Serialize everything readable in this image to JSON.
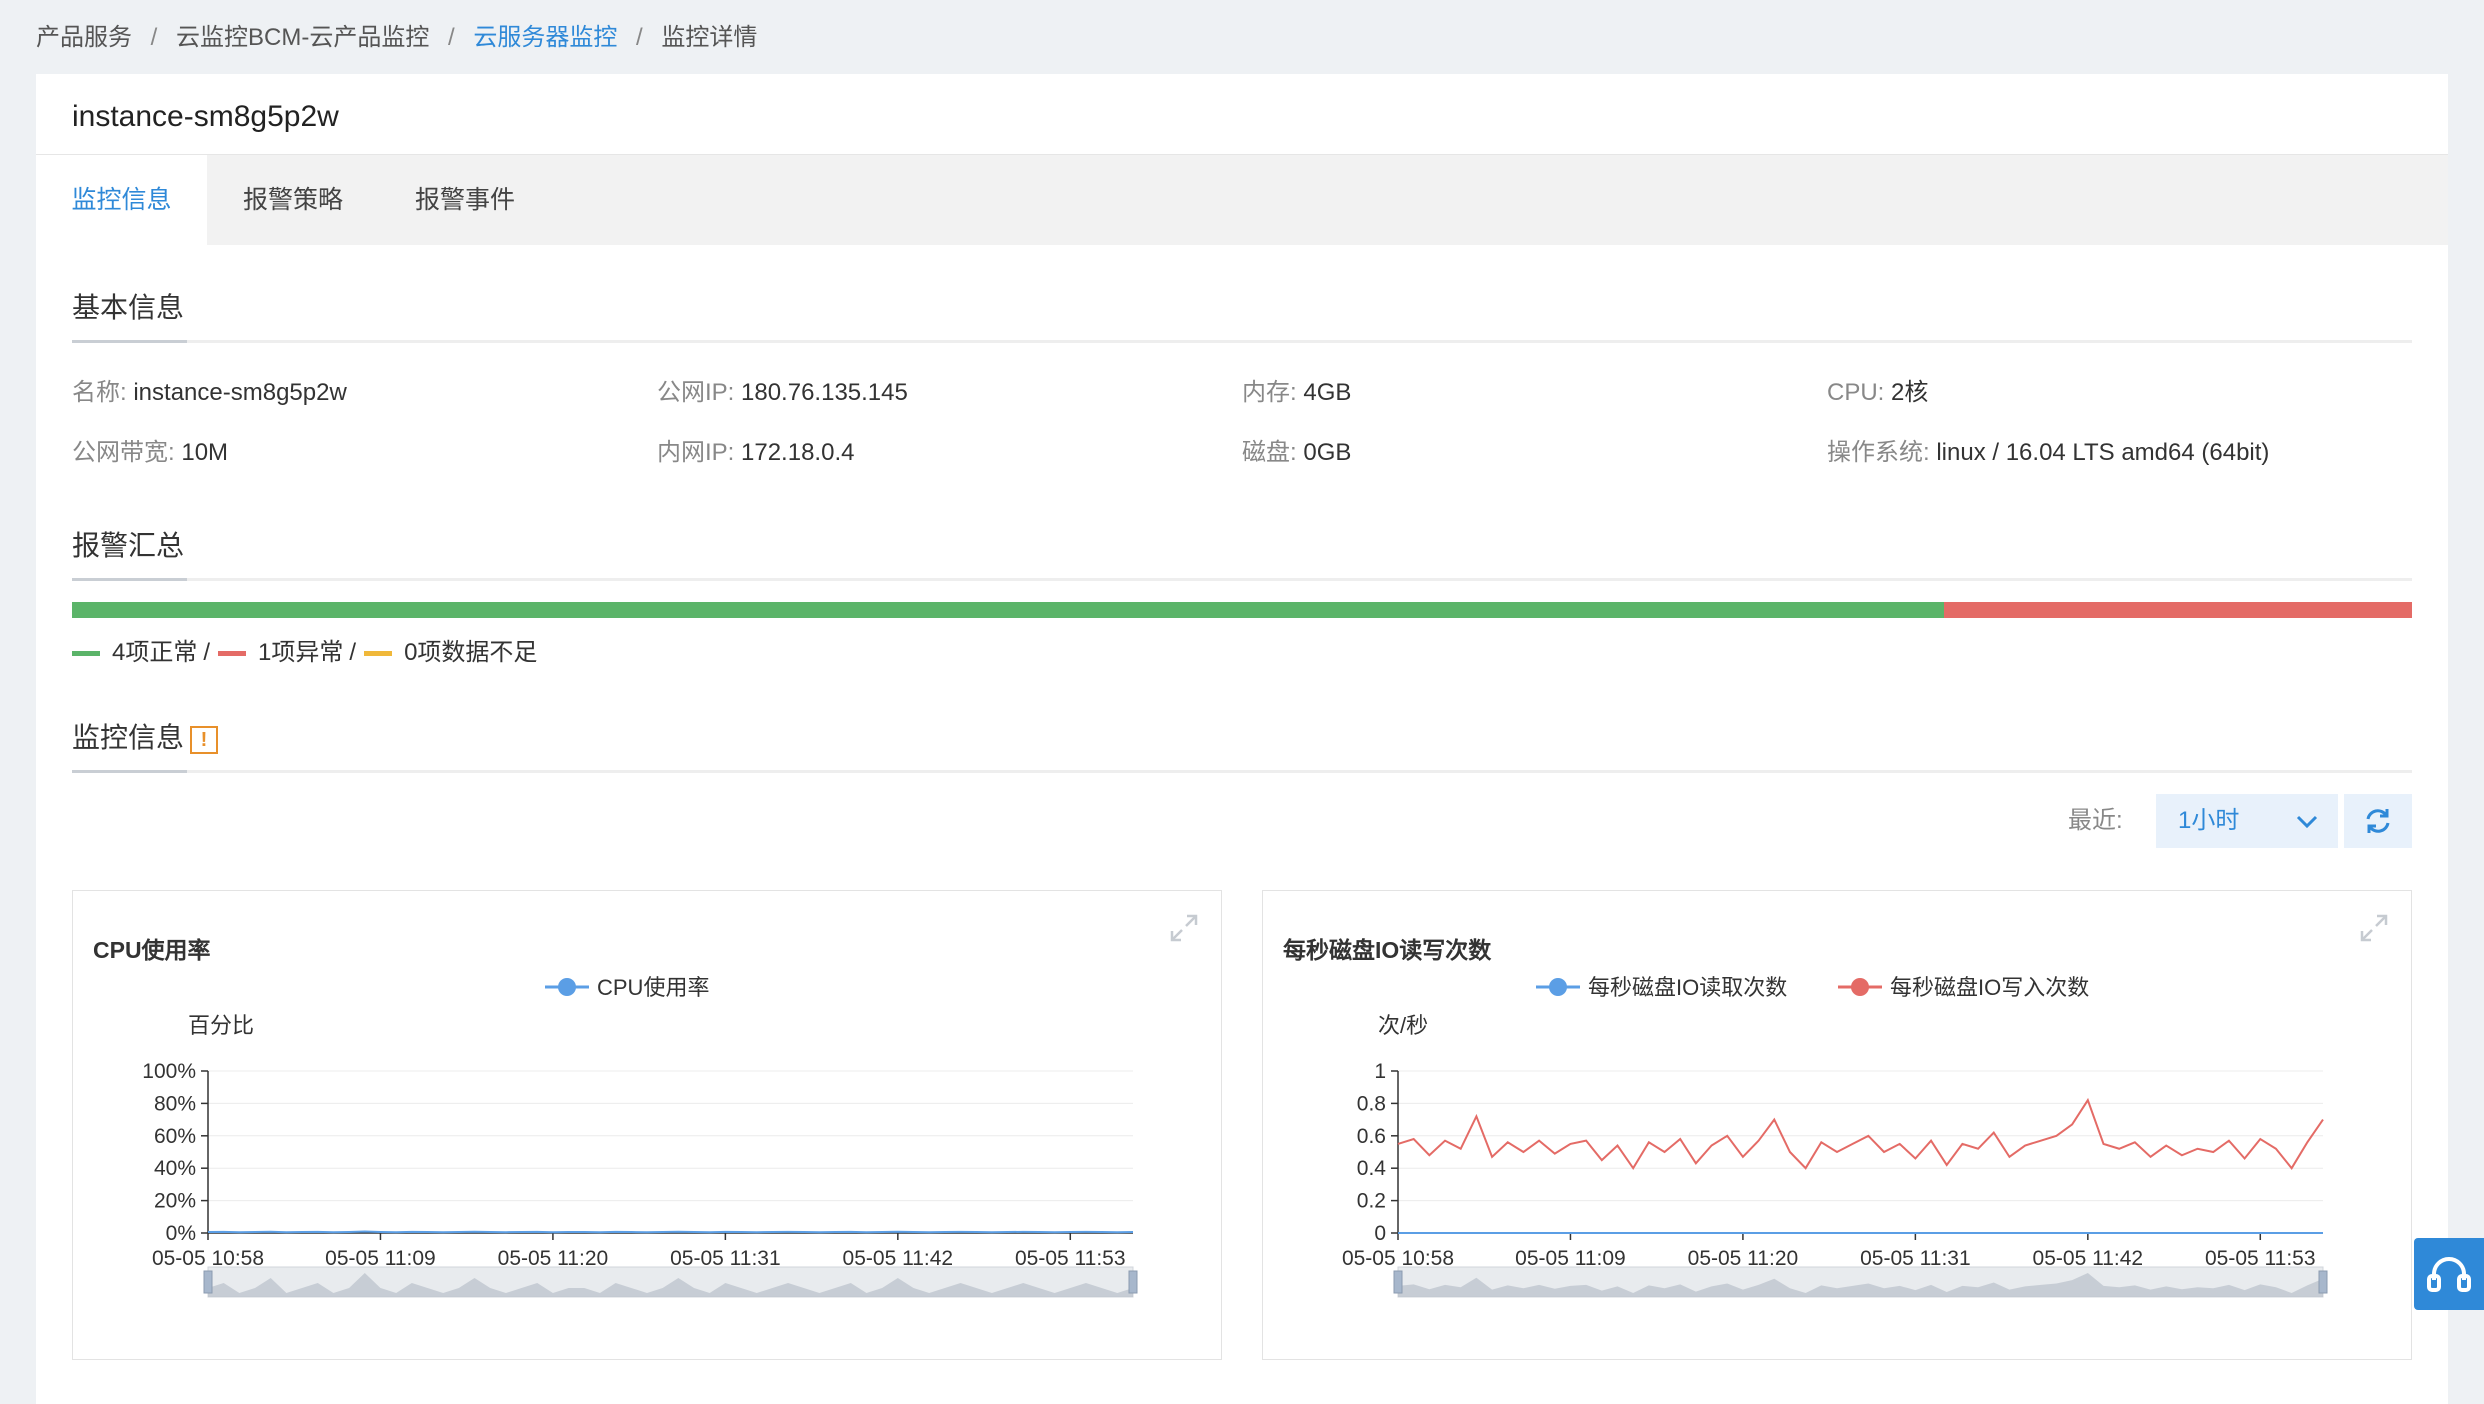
{
  "breadcrumb": [
    {
      "label": "产品服务",
      "link": false
    },
    {
      "label": "云监控BCM-云产品监控",
      "link": false
    },
    {
      "label": "云服务器监控",
      "link": true
    },
    {
      "label": "监控详情",
      "link": false
    }
  ],
  "breadcrumb_sep": "/",
  "instance_title": "instance-sm8g5p2w",
  "tabs": [
    "监控信息",
    "报警策略",
    "报警事件"
  ],
  "active_tab": "监控信息",
  "basic_info": {
    "title": "基本信息",
    "rows": [
      [
        {
          "key": "名称:",
          "value": "instance-sm8g5p2w"
        },
        {
          "key": "公网IP:",
          "value": "180.76.135.145"
        },
        {
          "key": "内存:",
          "value": "4GB"
        },
        {
          "key": "CPU:",
          "value": "2核"
        }
      ],
      [
        {
          "key": "公网带宽:",
          "value": "10M"
        },
        {
          "key": "内网IP:",
          "value": "172.18.0.4"
        },
        {
          "key": "磁盘:",
          "value": "0GB"
        },
        {
          "key": "操作系统:",
          "value": "linux / 16.04 LTS amd64 (64bit)"
        }
      ]
    ]
  },
  "alarm_summary": {
    "title": "报警汇总",
    "normal_count": 4,
    "abnormal_count": 1,
    "insufficient_count": 0,
    "normal_label": "4项正常",
    "abnormal_label": "1项异常",
    "insufficient_label": "0项数据不足",
    "separator": "/",
    "colors": {
      "normal": "#5bb469",
      "abnormal": "#e46b66",
      "insufficient": "#f0b83a"
    }
  },
  "monitor": {
    "title": "监控信息",
    "warn_glyph": "!",
    "recent_label": "最近:",
    "range_value": "1小时",
    "refresh_icon": "refresh-icon"
  },
  "chart_data": [
    {
      "type": "line",
      "title": "CPU使用率",
      "ylabel": "百分比",
      "yticks": [
        "0%",
        "20%",
        "40%",
        "60%",
        "80%",
        "100%"
      ],
      "ylim": [
        0,
        100
      ],
      "xticks": [
        "05-05 10:58",
        "05-05 11:09",
        "05-05 11:20",
        "05-05 11:31",
        "05-05 11:42",
        "05-05 11:53"
      ],
      "xlim": [
        0,
        59
      ],
      "series": [
        {
          "name": "CPU使用率",
          "color": "#5b9ee5",
          "values": [
            0.6,
            0.7,
            0.5,
            0.6,
            0.8,
            0.5,
            0.6,
            0.7,
            0.5,
            0.6,
            0.9,
            0.6,
            0.5,
            0.7,
            0.6,
            0.5,
            0.6,
            0.8,
            0.6,
            0.5,
            0.6,
            0.7,
            0.5,
            0.6,
            0.6,
            0.5,
            0.7,
            0.6,
            0.5,
            0.6,
            0.8,
            0.6,
            0.5,
            0.7,
            0.6,
            0.5,
            0.6,
            0.7,
            0.6,
            0.5,
            0.6,
            0.7,
            0.5,
            0.6,
            0.8,
            0.6,
            0.5,
            0.6,
            0.7,
            0.6,
            0.5,
            0.6,
            0.7,
            0.6,
            0.5,
            0.6,
            0.7,
            0.6,
            0.5,
            0.6
          ]
        }
      ]
    },
    {
      "type": "line",
      "title": "每秒磁盘IO读写次数",
      "ylabel": "次/秒",
      "yticks": [
        "0",
        "0.2",
        "0.4",
        "0.6",
        "0.8",
        "1"
      ],
      "ylim": [
        0,
        1
      ],
      "xticks": [
        "05-05 10:58",
        "05-05 11:09",
        "05-05 11:20",
        "05-05 11:31",
        "05-05 11:42",
        "05-05 11:53"
      ],
      "xlim": [
        0,
        59
      ],
      "series": [
        {
          "name": "每秒磁盘IO读取次数",
          "color": "#5b9ee5",
          "values": [
            0,
            0,
            0,
            0,
            0,
            0,
            0,
            0,
            0,
            0,
            0,
            0,
            0,
            0,
            0,
            0,
            0,
            0,
            0,
            0,
            0,
            0,
            0,
            0,
            0,
            0,
            0,
            0,
            0,
            0,
            0,
            0,
            0,
            0,
            0,
            0,
            0,
            0,
            0,
            0,
            0,
            0,
            0,
            0,
            0,
            0,
            0,
            0,
            0,
            0,
            0,
            0,
            0,
            0,
            0,
            0,
            0,
            0,
            0,
            0
          ]
        },
        {
          "name": "每秒磁盘IO写入次数",
          "color": "#e46b66",
          "values": [
            0.55,
            0.58,
            0.48,
            0.57,
            0.52,
            0.72,
            0.47,
            0.56,
            0.5,
            0.57,
            0.49,
            0.55,
            0.57,
            0.45,
            0.54,
            0.4,
            0.56,
            0.5,
            0.58,
            0.43,
            0.54,
            0.6,
            0.47,
            0.57,
            0.7,
            0.5,
            0.4,
            0.56,
            0.5,
            0.55,
            0.6,
            0.5,
            0.55,
            0.46,
            0.57,
            0.42,
            0.55,
            0.52,
            0.62,
            0.47,
            0.54,
            0.57,
            0.6,
            0.67,
            0.82,
            0.55,
            0.52,
            0.56,
            0.47,
            0.54,
            0.48,
            0.52,
            0.5,
            0.57,
            0.46,
            0.58,
            0.52,
            0.4,
            0.56,
            0.7
          ]
        }
      ]
    }
  ]
}
